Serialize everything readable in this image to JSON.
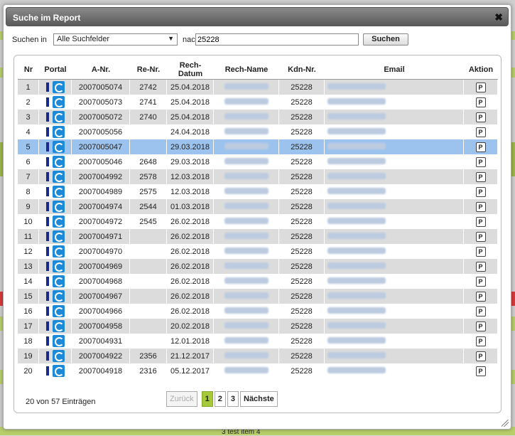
{
  "dialog": {
    "title": "Suche im Report",
    "close_glyph": "✖"
  },
  "search": {
    "label": "Suchen in",
    "field_selected": "Alle Suchfelder",
    "after_label": "nach",
    "value": "25228",
    "button": "Suchen"
  },
  "table": {
    "headers": [
      "Nr",
      "Portal",
      "A-Nr.",
      "Re-Nr.",
      "Rech-Datum",
      "Rech-Name",
      "Kdn-Nr.",
      "Email",
      "Aktion"
    ],
    "action_glyph": "P",
    "rows": [
      {
        "nr": "1",
        "anr": "2007005074",
        "renr": "2742",
        "date": "25.04.2018",
        "kdn": "25228"
      },
      {
        "nr": "2",
        "anr": "2007005073",
        "renr": "2741",
        "date": "25.04.2018",
        "kdn": "25228"
      },
      {
        "nr": "3",
        "anr": "2007005072",
        "renr": "2740",
        "date": "25.04.2018",
        "kdn": "25228"
      },
      {
        "nr": "4",
        "anr": "2007005056",
        "renr": "",
        "date": "24.04.2018",
        "kdn": "25228"
      },
      {
        "nr": "5",
        "anr": "2007005047",
        "renr": "",
        "date": "29.03.2018",
        "kdn": "25228"
      },
      {
        "nr": "6",
        "anr": "2007005046",
        "renr": "2648",
        "date": "29.03.2018",
        "kdn": "25228"
      },
      {
        "nr": "7",
        "anr": "2007004992",
        "renr": "2578",
        "date": "12.03.2018",
        "kdn": "25228"
      },
      {
        "nr": "8",
        "anr": "2007004989",
        "renr": "2575",
        "date": "12.03.2018",
        "kdn": "25228"
      },
      {
        "nr": "9",
        "anr": "2007004974",
        "renr": "2544",
        "date": "01.03.2018",
        "kdn": "25228"
      },
      {
        "nr": "10",
        "anr": "2007004972",
        "renr": "2545",
        "date": "26.02.2018",
        "kdn": "25228"
      },
      {
        "nr": "11",
        "anr": "2007004971",
        "renr": "",
        "date": "26.02.2018",
        "kdn": "25228"
      },
      {
        "nr": "12",
        "anr": "2007004970",
        "renr": "",
        "date": "26.02.2018",
        "kdn": "25228"
      },
      {
        "nr": "13",
        "anr": "2007004969",
        "renr": "",
        "date": "26.02.2018",
        "kdn": "25228"
      },
      {
        "nr": "14",
        "anr": "2007004968",
        "renr": "",
        "date": "26.02.2018",
        "kdn": "25228"
      },
      {
        "nr": "15",
        "anr": "2007004967",
        "renr": "",
        "date": "26.02.2018",
        "kdn": "25228"
      },
      {
        "nr": "16",
        "anr": "2007004966",
        "renr": "",
        "date": "26.02.2018",
        "kdn": "25228"
      },
      {
        "nr": "17",
        "anr": "2007004958",
        "renr": "",
        "date": "20.02.2018",
        "kdn": "25228"
      },
      {
        "nr": "18",
        "anr": "2007004931",
        "renr": "",
        "date": "12.01.2018",
        "kdn": "25228"
      },
      {
        "nr": "19",
        "anr": "2007004922",
        "renr": "2356",
        "date": "21.12.2017",
        "kdn": "25228"
      },
      {
        "nr": "20",
        "anr": "2007004918",
        "renr": "2316",
        "date": "05.12.2017",
        "kdn": "25228"
      }
    ],
    "selected_row": "5"
  },
  "footer": {
    "count": "20 von 57 Einträgen",
    "prev": "Zurück",
    "pages": [
      "1",
      "2",
      "3"
    ],
    "active_page": "1",
    "next": "Nächste"
  },
  "background": {
    "bottom_text": "3   test item 4"
  }
}
